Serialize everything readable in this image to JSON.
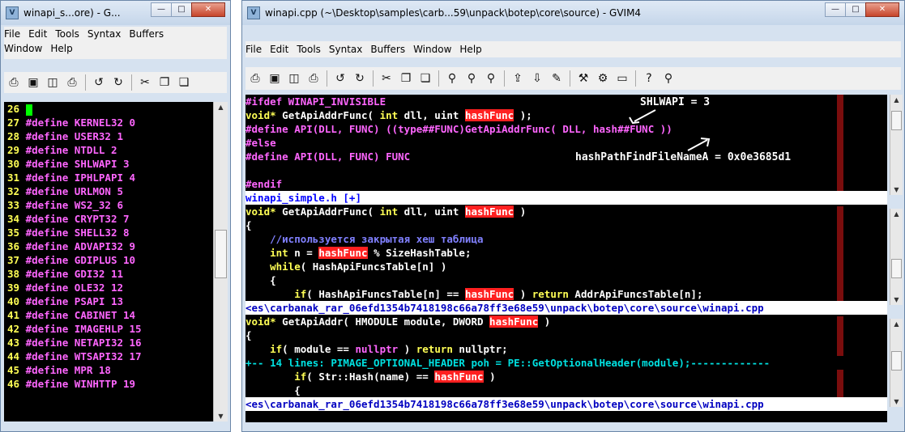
{
  "left_window": {
    "title": "winapi_s...ore) - G...",
    "menu": [
      "File",
      "Edit",
      "Tools",
      "Syntax",
      "Buffers",
      "Window",
      "Help"
    ],
    "lines": [
      {
        "n": "26",
        "text": ""
      },
      {
        "n": "27",
        "text": "#define KERNEL32 0"
      },
      {
        "n": "28",
        "text": "#define USER32 1"
      },
      {
        "n": "29",
        "text": "#define NTDLL 2"
      },
      {
        "n": "30",
        "text": "#define SHLWAPI 3"
      },
      {
        "n": "31",
        "text": "#define IPHLPAPI 4"
      },
      {
        "n": "32",
        "text": "#define URLMON 5"
      },
      {
        "n": "33",
        "text": "#define WS2_32 6"
      },
      {
        "n": "34",
        "text": "#define CRYPT32 7"
      },
      {
        "n": "35",
        "text": "#define SHELL32 8"
      },
      {
        "n": "36",
        "text": "#define ADVAPI32 9"
      },
      {
        "n": "37",
        "text": "#define GDIPLUS 10"
      },
      {
        "n": "38",
        "text": "#define GDI32 11"
      },
      {
        "n": "39",
        "text": "#define OLE32 12"
      },
      {
        "n": "40",
        "text": "#define PSAPI 13"
      },
      {
        "n": "41",
        "text": "#define CABINET 14"
      },
      {
        "n": "42",
        "text": "#define IMAGEHLP 15"
      },
      {
        "n": "43",
        "text": "#define NETAPI32 16"
      },
      {
        "n": "44",
        "text": "#define WTSAPI32 17"
      },
      {
        "n": "45",
        "text": "#define MPR 18"
      },
      {
        "n": "46",
        "text": "#define WINHTTP 19"
      }
    ]
  },
  "right_window": {
    "title": "winapi.cpp (~\\Desktop\\samples\\carb...59\\unpack\\botep\\core\\source) - GVIM4",
    "menu": [
      "File",
      "Edit",
      "Tools",
      "Syntax",
      "Buffers",
      "Window",
      "Help"
    ],
    "pane1": {
      "l1": "#ifdef WINAPI_INVISIBLE",
      "l2_kw": "void*",
      "l2_mid": " GetApiAddrFunc( ",
      "l2_int": "int",
      "l2_rest": " dll, uint ",
      "l2_hl": "hashFunc",
      "l2_end": " );",
      "l3": "#define API(DLL, FUNC) ((type##FUNC)GetApiAddrFunc( DLL, hash##FUNC ))",
      "l4": "#else",
      "l5": "#define API(DLL, FUNC) FUNC",
      "l6": "",
      "l7": "#endif"
    },
    "status1": "winapi_simple.h [+]",
    "pane2": {
      "l1_kw": "void*",
      "l1_mid": " GetApiAddrFunc( ",
      "l1_int": "int",
      "l1_rest": " dll, uint ",
      "l1_hl": "hashFunc",
      "l1_end": " )",
      "l2": "{",
      "l3": "    //используется закрытая хеш таблица",
      "l4_int": "int",
      "l4_mid": " n = ",
      "l4_hl": "hashFunc",
      "l4_end": " % SizeHashTable;",
      "l5_kw": "while",
      "l5_end": "( HashApiFuncsTable[n] )",
      "l6": "    {",
      "l7_kw": "if",
      "l7_mid": "( HashApiFuncsTable[n] == ",
      "l7_hl": "hashFunc",
      "l7_mid2": " ) ",
      "l7_ret": "return",
      "l7_end": " AddrApiFuncsTable[n];"
    },
    "status2": "<es\\carbanak_rar_06efd1354b7418198c66a78ff3e68e59\\unpack\\botep\\core\\source\\winapi.cpp",
    "pane3": {
      "l1_kw": "void*",
      "l1_mid": " GetApiAddr( HMODULE module, DWORD ",
      "l1_hl": "hashFunc",
      "l1_end": " )",
      "l2": "{",
      "l3_kw": "if",
      "l3_mid": "( module == ",
      "l3_null": "nullptr",
      "l3_mid2": " ) ",
      "l3_ret": "return",
      "l3_end": " nullptr;",
      "fold": "+-- 14 lines: PIMAGE_OPTIONAL_HEADER poh = PE::GetOptionalHeader(module);-------------",
      "l5_kw": "if",
      "l5_mid": "( Str::Hash(name) == ",
      "l5_hl": "hashFunc",
      "l5_end": " )",
      "l6": "        {"
    },
    "status3": "<es\\carbanak_rar_06efd1354b7418198c66a78ff3e68e59\\unpack\\botep\\core\\source\\winapi.cpp",
    "annotations": {
      "shlwapi": "SHLWAPI = 3",
      "hash": "hashPathFindFileNameA = 0x0e3685d1"
    }
  },
  "colors": {
    "highlight": "#ff2020",
    "keyword": "#ffff55",
    "preproc": "#ff66ff",
    "comment": "#8080ff",
    "cursor": "#00ff00"
  },
  "icons": [
    "open-icon",
    "save-icon",
    "save-all-icon",
    "print-icon",
    "undo-icon",
    "redo-icon",
    "cut-icon",
    "copy-icon",
    "paste-icon",
    "find-replace-icon",
    "find-next-icon",
    "find-prev-icon",
    "load-session-icon",
    "save-session-icon",
    "run-script-icon",
    "make-icon",
    "shell-icon",
    "ctags-icon",
    "help-icon",
    "find-help-icon"
  ]
}
